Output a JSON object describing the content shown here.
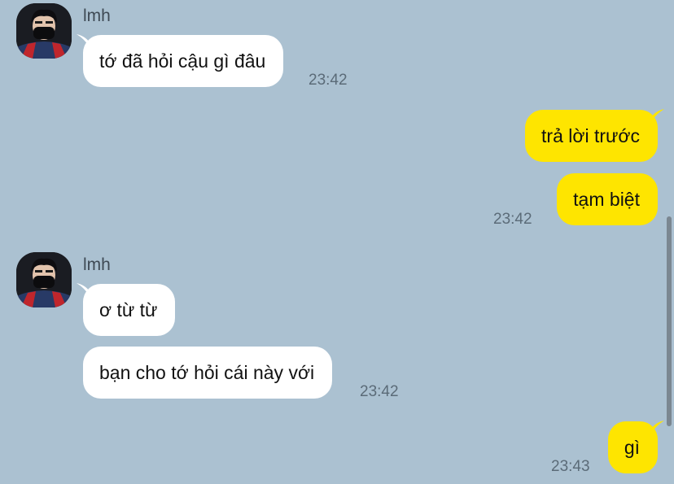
{
  "colors": {
    "background": "#abc1d1",
    "incoming_bubble": "#ffffff",
    "outgoing_bubble": "#fee500",
    "timestamp": "#5b6b78"
  },
  "messages": {
    "group1": {
      "sender": "lmh",
      "avatar_icon": "user-avatar-photo",
      "bubbles": [
        "tớ đã hỏi cậu gì đâu"
      ],
      "time": "23:42"
    },
    "group2": {
      "bubbles": [
        "trả lời trước",
        "tạm biệt"
      ],
      "time": "23:42"
    },
    "group3": {
      "sender": "lmh",
      "avatar_icon": "user-avatar-photo",
      "bubbles": [
        "ơ từ từ",
        "bạn cho tớ hỏi cái này với"
      ],
      "time": "23:42"
    },
    "group4": {
      "bubbles": [
        "gì"
      ],
      "time": "23:43"
    }
  }
}
